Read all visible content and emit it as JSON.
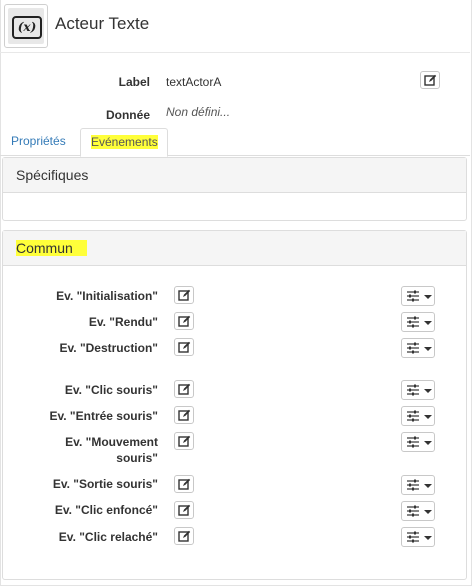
{
  "header": {
    "icon_text": "(x)",
    "icon": "variable-x-icon",
    "title": "Acteur Texte"
  },
  "fields": [
    {
      "label": "Label",
      "value": "textActorA"
    },
    {
      "label": "Donnée",
      "value": "Non défini..."
    }
  ],
  "tabs": [
    {
      "label": "Propriétés",
      "active": false
    },
    {
      "label": "Evénements",
      "active": true
    }
  ],
  "panels": {
    "specific": {
      "title": "Spécifiques"
    },
    "common": {
      "title": "Commun"
    }
  },
  "events": [
    {
      "label": "Ev. \"Initialisation\""
    },
    {
      "label": "Ev. \"Rendu\""
    },
    {
      "label": "Ev. \"Destruction\""
    },
    {
      "label": "Ev. \"Clic souris\""
    },
    {
      "label": "Ev. \"Entrée souris\""
    },
    {
      "label": "Ev. \"Mouvement souris\""
    },
    {
      "label": "Ev. \"Sortie souris\""
    },
    {
      "label": "Ev. \"Clic enfoncé\""
    },
    {
      "label": "Ev. \"Clic relaché\""
    }
  ],
  "colors": {
    "highlight": "#ffff3a",
    "link": "#337ab7",
    "panel_head": "#f5f5f5"
  }
}
